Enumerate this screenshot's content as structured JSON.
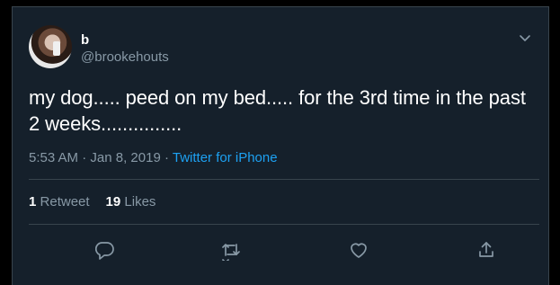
{
  "tweet": {
    "display_name": "b",
    "handle": "@brookehouts",
    "text": "my dog..... peed on my bed..... for the 3rd time in the past 2 weeks...............",
    "time": "5:53 AM",
    "separator": " · ",
    "date": "Jan 8, 2019",
    "source": "Twitter for iPhone"
  },
  "stats": {
    "retweets_count": "1",
    "retweets_label": "Retweet",
    "likes_count": "19",
    "likes_label": "Likes"
  },
  "actions": {
    "reply_icon": "reply-icon",
    "retweet_icon": "retweet-icon",
    "like_icon": "heart-icon",
    "share_icon": "share-icon"
  },
  "colors": {
    "background": "#15202b",
    "border": "#38444d",
    "secondary_text": "#8899a6",
    "link": "#1da1f2"
  }
}
